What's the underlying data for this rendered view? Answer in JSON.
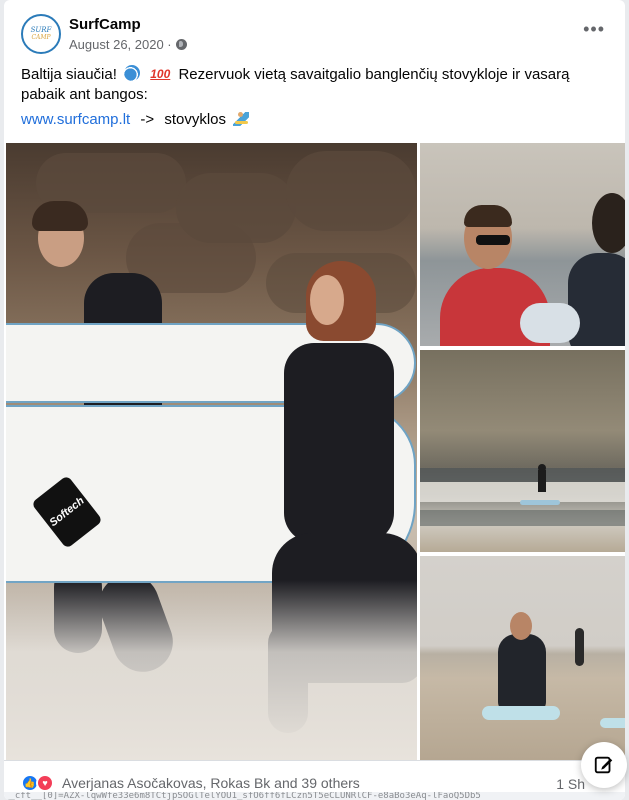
{
  "post": {
    "author": "SurfCamp",
    "avatar_text": [
      "SURF",
      "CAMP"
    ],
    "date": "August 26, 2020 ·",
    "privacy_icon": "globe-icon",
    "more_icon": "more-options-icon",
    "text_part1": "Baltija siaučia!",
    "text_part2": "Rezervuok vietą savaitgalio banglenčių stovykloje ir vasarą pabaik ant bangos:",
    "emoji_100": "100",
    "link_text": "www.surfcamp.lt",
    "arrow": "->",
    "link_suffix": "stovyklos"
  },
  "photos": {
    "main_alt": "Two surfers in wetsuits carrying surfboards out of the water",
    "board_logo": "Softech",
    "top_right_alt": "Smiling surfer in red wetsuit wearing sunglasses",
    "middle_right_alt": "Surfer riding a wave at sunset",
    "bottom_right_alt": "Surfer kneeling on board on the beach"
  },
  "footer": {
    "reactors": "Averjanas Asočakovas, Rokas Bk and 39 others",
    "shares": "1 Sh",
    "url_strip": "__cft__[0]=AZX-lqwWfe33e6m8TCtjpSOGlTelYOU1_sfO6ff6fLCzn5T5eCLUNRlCF-e8aBo3eAq-lFaoQ5Db5"
  },
  "colors": {
    "link": "#216fdb",
    "like": "#1877f2",
    "love": "#f33e58"
  }
}
